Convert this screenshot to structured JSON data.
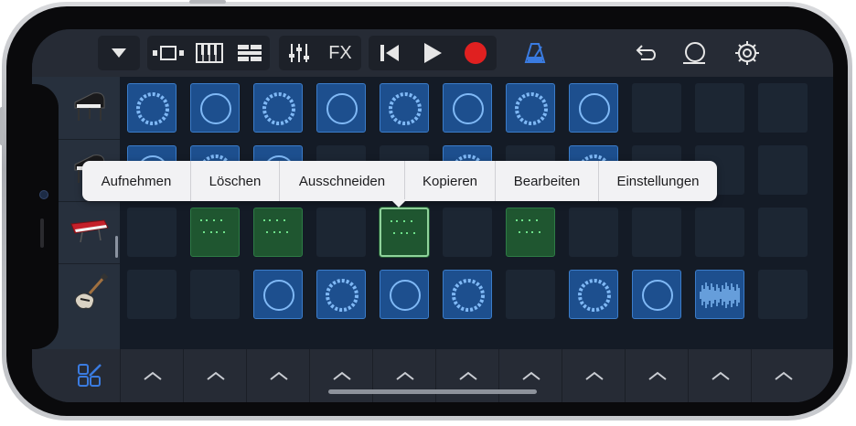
{
  "toolbar": {
    "fx_label": "FX",
    "icons": [
      "chevron-down-icon",
      "tracks-view-icon",
      "keyboard-icon",
      "live-loops-icon",
      "mixer-icon",
      "fx-icon",
      "rewind-icon",
      "play-icon",
      "record-icon",
      "metronome-icon",
      "undo-icon",
      "loop-browser-icon",
      "settings-icon"
    ],
    "colors": {
      "record": "#e02020",
      "metronome": "#3a7be0"
    }
  },
  "tracks": [
    {
      "name": "grand-piano-icon"
    },
    {
      "name": "piano-icon"
    },
    {
      "name": "synth-keyboard-icon"
    },
    {
      "name": "electric-guitar-icon"
    }
  ],
  "context_menu": {
    "items": [
      "Aufnehmen",
      "Löschen",
      "Ausschneiden",
      "Kopieren",
      "Bearbeiten",
      "Einstellungen"
    ]
  },
  "bottom_bar": {
    "edit_icon": "grid-edit-icon",
    "trigger_icon": "chevron-up-icon"
  }
}
